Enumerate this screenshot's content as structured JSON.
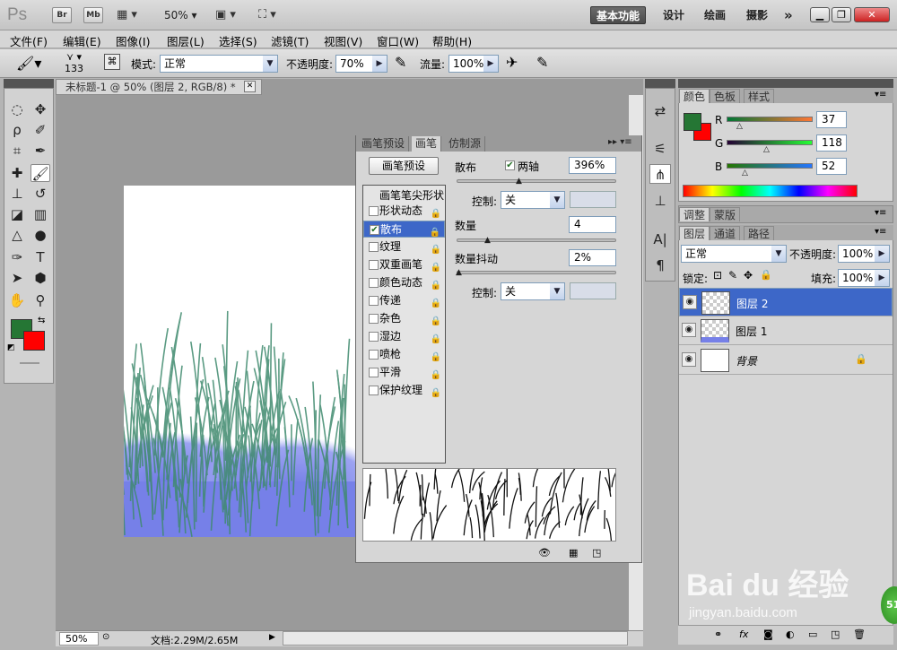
{
  "app": {
    "logo": "Ps",
    "bridge_btn": "Br",
    "minibridge_btn": "Mb",
    "zoom": "50%",
    "workspaces": [
      "基本功能",
      "设计",
      "绘画",
      "摄影"
    ],
    "more": "»"
  },
  "menu": [
    "文件(F)",
    "编辑(E)",
    "图像(I)",
    "图层(L)",
    "选择(S)",
    "滤镜(T)",
    "视图(V)",
    "窗口(W)",
    "帮助(H)"
  ],
  "options": {
    "brush_size": "133",
    "mode_label": "模式:",
    "mode_value": "正常",
    "opacity_label": "不透明度:",
    "opacity_value": "70%",
    "flow_label": "流量:",
    "flow_value": "100%"
  },
  "document": {
    "tab_title": "未标题-1 @ 50% (图层 2, RGB/8) *",
    "status_zoom": "50%",
    "status_doc": "文档:2.29M/2.65M"
  },
  "brush_panel": {
    "tabs": [
      "画笔预设",
      "画笔",
      "仿制源"
    ],
    "preset_button": "画笔预设",
    "list_header": "画笔笔尖形状",
    "items": [
      {
        "label": "形状动态",
        "checked": false
      },
      {
        "label": "散布",
        "checked": true
      },
      {
        "label": "纹理",
        "checked": false
      },
      {
        "label": "双重画笔",
        "checked": false
      },
      {
        "label": "颜色动态",
        "checked": false
      },
      {
        "label": "传递",
        "checked": false
      },
      {
        "label": "杂色",
        "checked": false
      },
      {
        "label": "湿边",
        "checked": false
      },
      {
        "label": "喷枪",
        "checked": false
      },
      {
        "label": "平滑",
        "checked": false
      },
      {
        "label": "保护纹理",
        "checked": false
      }
    ],
    "scatter_label": "散布",
    "both_axes_label": "两轴",
    "scatter_value": "396%",
    "control_label": "控制:",
    "control1_value": "关",
    "count_label": "数量",
    "count_value": "4",
    "count_jitter_label": "数量抖动",
    "count_jitter_value": "2%",
    "control2_value": "关"
  },
  "color_panel": {
    "tabs": [
      "颜色",
      "色板",
      "样式"
    ],
    "r_label": "R",
    "r_value": "37",
    "g_label": "G",
    "g_value": "118",
    "b_label": "B",
    "b_value": "52",
    "fg_color": "#257634",
    "bg_color": "#ff0000"
  },
  "adj_panel": {
    "tabs": [
      "调整",
      "蒙版"
    ]
  },
  "layers_panel": {
    "tabs": [
      "图层",
      "通道",
      "路径"
    ],
    "blend_mode": "正常",
    "opacity_label": "不透明度:",
    "opacity_value": "100%",
    "lock_label": "锁定:",
    "fill_label": "填充:",
    "fill_value": "100%",
    "layers": [
      {
        "name": "图层 2",
        "selected": true
      },
      {
        "name": "图层 1",
        "selected": false
      },
      {
        "name": "背景",
        "selected": false
      }
    ]
  },
  "watermark": {
    "logo": "Bai du 经验",
    "url": "jingyan.baidu.com",
    "badge": "51"
  }
}
